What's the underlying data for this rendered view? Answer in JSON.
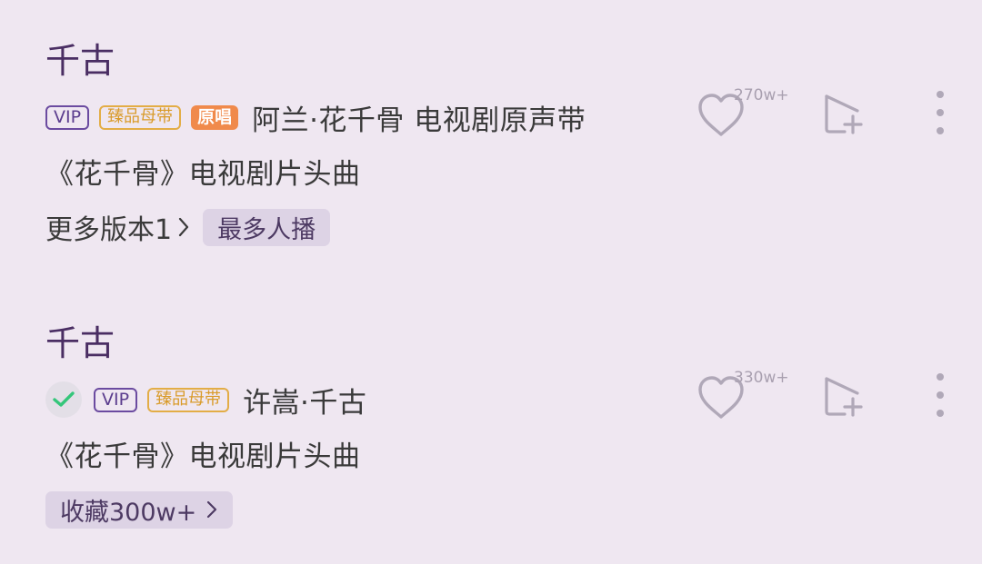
{
  "songs": [
    {
      "title": "千古",
      "tags": {
        "vip": "VIP",
        "zhenpin": "臻品母带",
        "yuanchang": "原唱"
      },
      "artist": "阿兰·花千骨 电视剧原声带",
      "description": "《花千骨》电视剧片头曲",
      "more_versions": "更多版本1",
      "badge": "最多人播",
      "like_count": "270w+"
    },
    {
      "title": "千古",
      "tags": {
        "vip": "VIP",
        "zhenpin": "臻品母带"
      },
      "artist": "许嵩·千古",
      "description": "《花千骨》电视剧片头曲",
      "favorite_pill": "收藏300w+",
      "like_count": "330w+"
    }
  ],
  "colors": {
    "background": "#efe7f1",
    "title": "#4a2e63",
    "vip": "#6b4ba0",
    "zhenpin": "#e3ad46",
    "yuanchang": "#f08a4b",
    "pill_bg": "#ddd3e5",
    "icon": "#b0a8b8",
    "check": "#34c67a"
  },
  "icons": {
    "like": "heart-outline-icon",
    "add": "add-to-playlist-icon",
    "more": "more-vertical-icon",
    "chevron": "chevron-right-icon",
    "downloaded": "check-circle-icon"
  }
}
